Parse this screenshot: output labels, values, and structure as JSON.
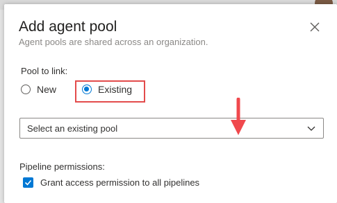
{
  "dialog": {
    "title": "Add agent pool",
    "subtitle": "Agent pools are shared across an organization.",
    "close_icon": "close-icon"
  },
  "pool_to_link": {
    "label": "Pool to link:",
    "options": [
      {
        "label": "New",
        "selected": false
      },
      {
        "label": "Existing",
        "selected": true
      }
    ],
    "highlight_color": "#e34b4b"
  },
  "existing_pool_select": {
    "value": "Select an existing pool",
    "icon": "chevron-down-icon"
  },
  "annotation_arrow": {
    "color": "#f0494d",
    "icon": "arrow-down-icon"
  },
  "pipeline_permissions": {
    "label": "Pipeline permissions:",
    "checkbox_label": "Grant access permission to all pipelines",
    "checked": true
  },
  "colors": {
    "accent": "#0078d4"
  }
}
